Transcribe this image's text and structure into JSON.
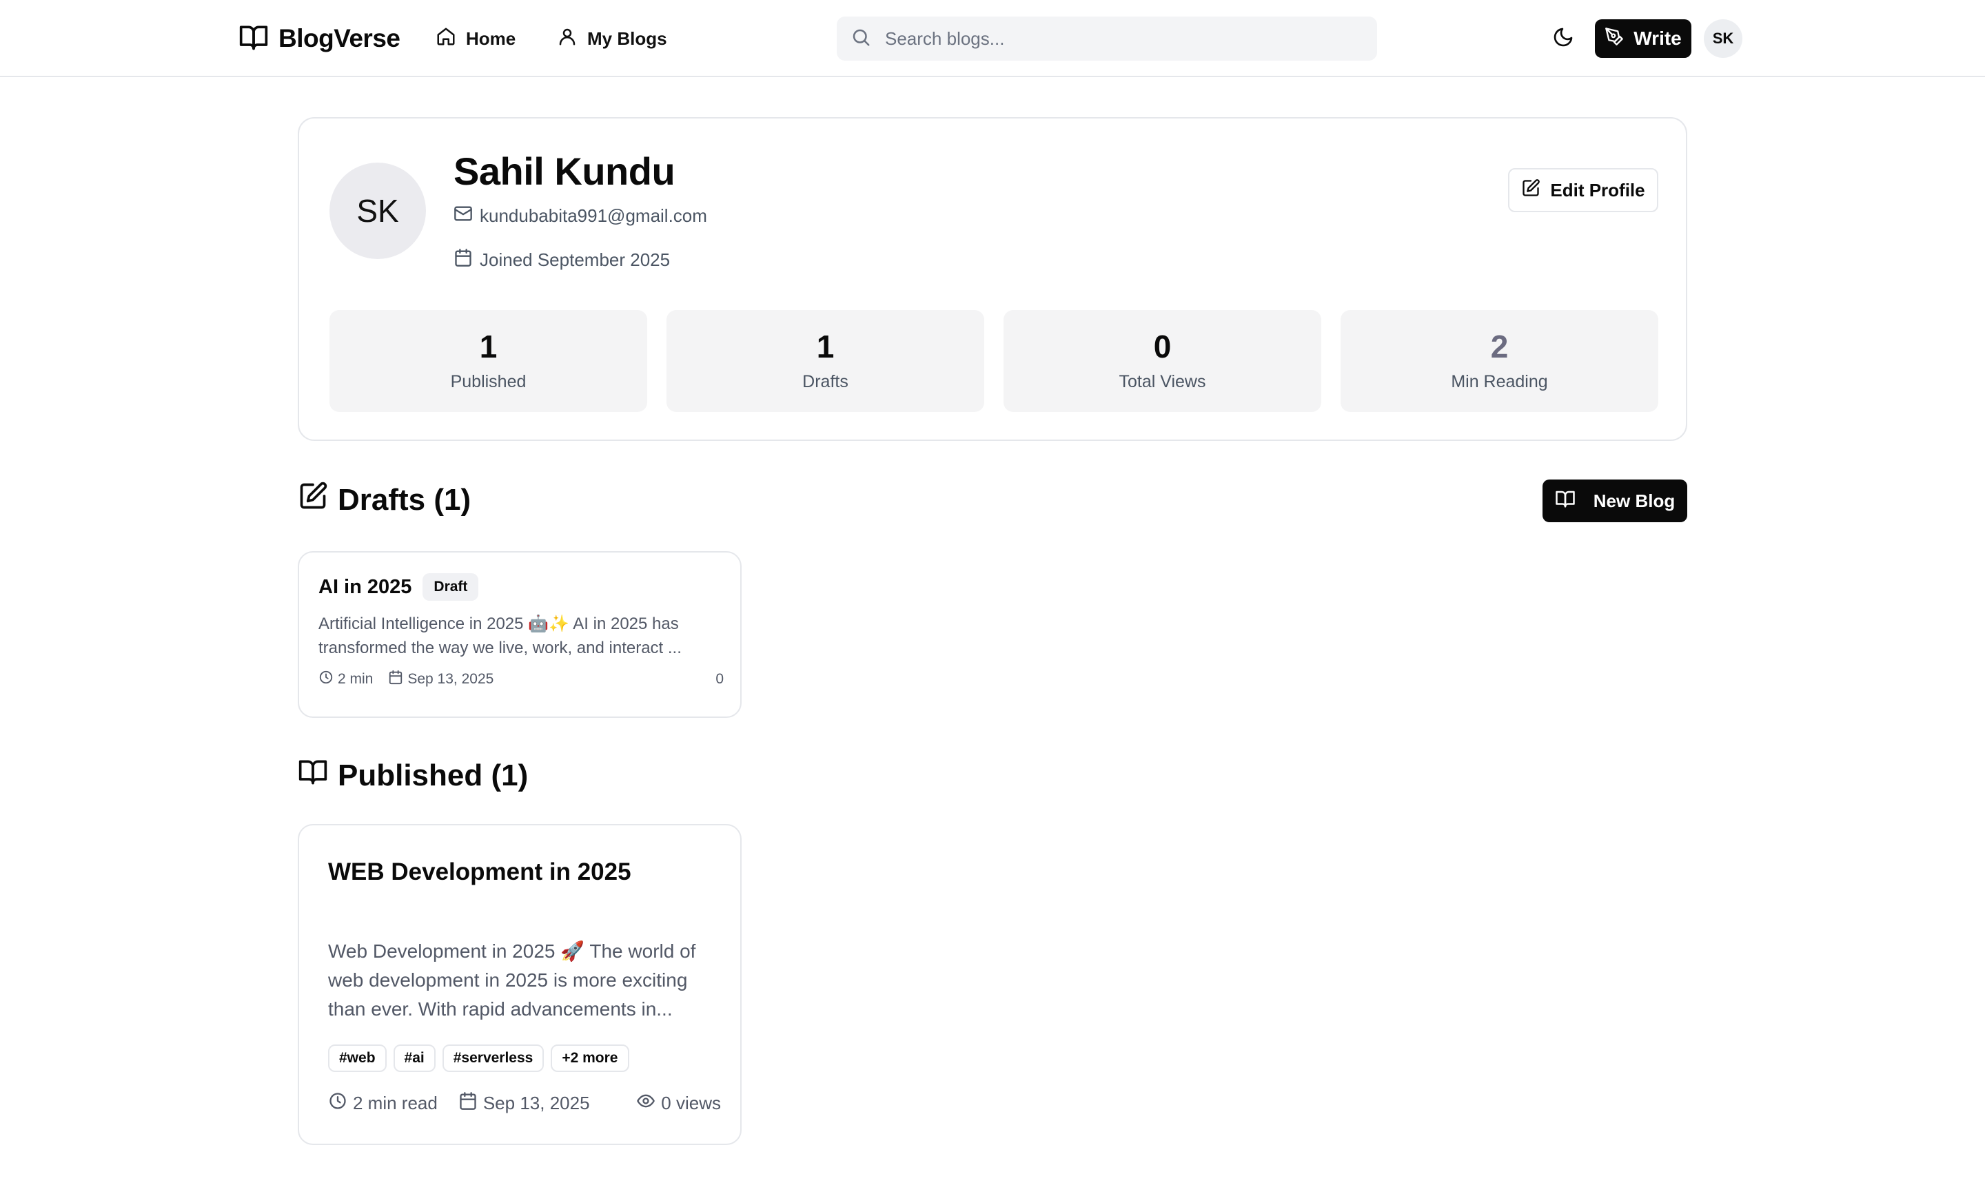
{
  "app": {
    "brand": "BlogVerse"
  },
  "nav": {
    "home_label": "Home",
    "myblogs_label": "My Blogs",
    "search_placeholder": "Search blogs...",
    "write_label": "Write",
    "avatar_initials": "SK"
  },
  "profile": {
    "initials": "SK",
    "name": "Sahil Kundu",
    "email": "kundubabita991@gmail.com",
    "joined": "Joined September 2025",
    "edit_label": "Edit Profile",
    "stats": [
      {
        "value": "1",
        "label": "Published"
      },
      {
        "value": "1",
        "label": "Drafts"
      },
      {
        "value": "0",
        "label": "Total Views"
      },
      {
        "value": "2",
        "label": "Min Reading"
      }
    ]
  },
  "drafts": {
    "title": "Drafts (1)",
    "new_blog_label": "New Blog",
    "items": [
      {
        "title": "AI in 2025",
        "badge": "Draft",
        "excerpt": "Artificial Intelligence in 2025 🤖✨ AI in 2025 has transformed the way we live, work, and interact ...",
        "read_time": "2 min",
        "date": "Sep 13, 2025",
        "views": "0"
      }
    ]
  },
  "published": {
    "title": "Published (1)",
    "items": [
      {
        "title": "WEB Development in 2025",
        "excerpt": "Web Development in 2025 🚀 The world of web development in 2025 is more exciting than ever. With rapid advancements in...",
        "tags": [
          "#web",
          "#ai",
          "#serverless",
          "+2 more"
        ],
        "read_time": "2 min read",
        "date": "Sep 13, 2025",
        "views": "0 views"
      }
    ]
  }
}
